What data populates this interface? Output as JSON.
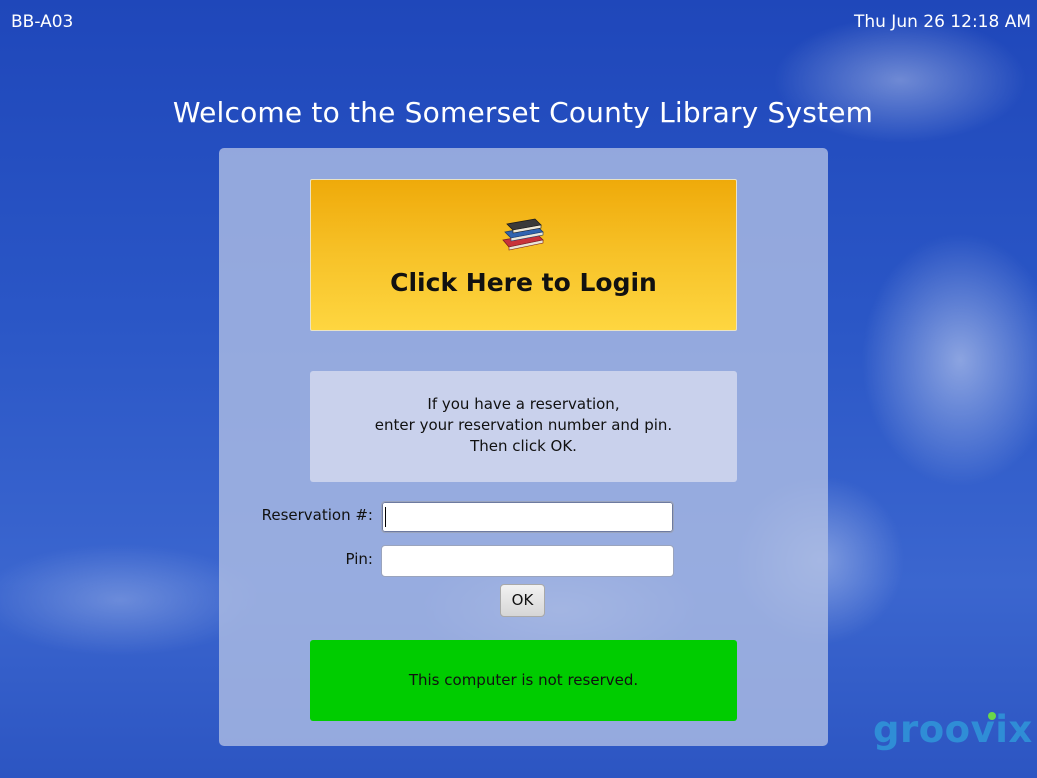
{
  "topbar": {
    "station_id": "BB-A03",
    "datetime": "Thu Jun 26 12:18 AM"
  },
  "welcome_title": "Welcome to the Somerset County Library System",
  "login": {
    "label": "Click Here to Login",
    "icon": "books-icon"
  },
  "reservation_info": {
    "line1": "If you have a reservation,",
    "line2": "enter your reservation number and pin.",
    "line3": "Then click OK."
  },
  "form": {
    "reservation_label": "Reservation #:",
    "reservation_value": "",
    "pin_label": "Pin:",
    "pin_value": "",
    "ok_label": "OK"
  },
  "status": {
    "text": "This computer is not reserved.",
    "color": "#00cc00"
  },
  "brand": {
    "name": "groovix",
    "color": "#2f8dd6"
  },
  "colors": {
    "login_button_top": "#efaa0a",
    "login_button_bottom": "#fed640",
    "background": "#2a56c6"
  }
}
